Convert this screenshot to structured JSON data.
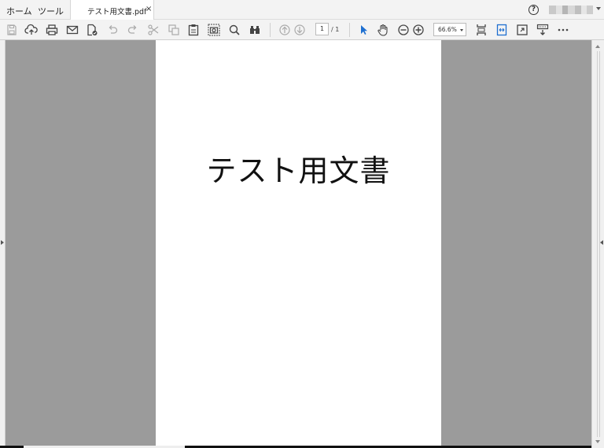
{
  "tabs": {
    "home": "ホーム",
    "tools": "ツール",
    "document": "テスト用文書.pdf",
    "close": "×"
  },
  "header": {
    "help": "?",
    "account_colors": [
      "#c9c9c9",
      "#e2e2e2",
      "#b5b5b5",
      "#d8d8d8",
      "#bfbfbf",
      "#e6e6e6",
      "#cdcdcd"
    ]
  },
  "toolbar": {
    "icons": [
      "save-icon",
      "upload-icon",
      "print-icon",
      "mail-icon",
      "protect-file-icon",
      "undo-icon",
      "redo-icon",
      "cut-icon",
      "copy-icon",
      "paste-icon",
      "snapshot-icon",
      "search-icon",
      "find-binoculars-icon",
      "page-up-icon",
      "page-down-icon",
      "select-cursor-icon",
      "hand-tool-icon",
      "zoom-out-icon",
      "zoom-in-icon",
      "fit-page-icon",
      "fit-width-icon",
      "full-screen-icon",
      "read-mode-icon",
      "more-icon"
    ],
    "page_current": "1",
    "page_total": "/ 1",
    "zoom_value": "66.6%"
  },
  "document": {
    "text": "テスト用文書"
  },
  "colors": {
    "accent": "#1e6fd0",
    "doc_background": "#9b9b9b"
  }
}
